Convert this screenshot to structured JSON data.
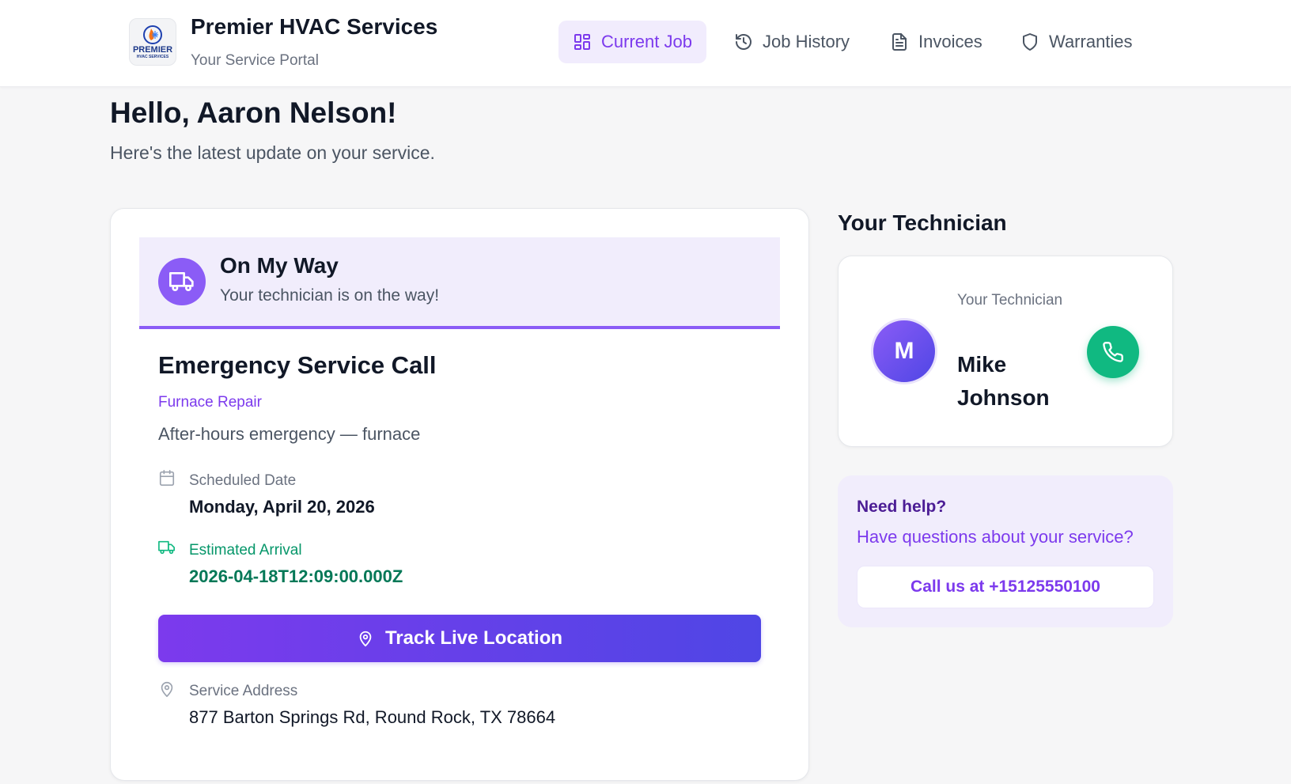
{
  "header": {
    "brand_title": "Premier HVAC Services",
    "brand_subtitle": "Your Service Portal",
    "logo_text": "PREMIER",
    "logo_subtext": "HVAC SERVICES",
    "nav": [
      {
        "label": "Current Job",
        "icon": "dashboard-grid-icon",
        "active": true
      },
      {
        "label": "Job History",
        "icon": "history-icon",
        "active": false
      },
      {
        "label": "Invoices",
        "icon": "document-icon",
        "active": false
      },
      {
        "label": "Warranties",
        "icon": "shield-icon",
        "active": false
      }
    ]
  },
  "greeting": {
    "title": "Hello, Aaron Nelson!",
    "subtitle": "Here's the latest update on your service."
  },
  "job": {
    "status": {
      "title": "On My Way",
      "subtitle": "Your technician is on the way!",
      "icon": "truck-icon"
    },
    "title": "Emergency Service Call",
    "type": "Furnace Repair",
    "description": "After-hours emergency — furnace",
    "scheduled": {
      "label": "Scheduled Date",
      "value": "Monday, April 20, 2026",
      "icon": "calendar-icon"
    },
    "arrival": {
      "label": "Estimated Arrival",
      "value": "2026-04-18T12:09:00.000Z",
      "icon": "truck-icon"
    },
    "track_button": "Track Live Location",
    "address": {
      "label": "Service Address",
      "value": "877 Barton Springs Rd, Round Rock, TX 78664",
      "icon": "map-pin-icon"
    }
  },
  "technician": {
    "heading": "Your Technician",
    "label": "Your Technician",
    "initial": "M",
    "name": "Mike Johnson"
  },
  "help": {
    "title": "Need help?",
    "subtitle": "Have questions about your service?",
    "button": "Call us at +15125550100"
  },
  "colors": {
    "accent": "#7c3aed",
    "accent_light": "#f1edfc",
    "success": "#10b981",
    "text": "#111827"
  }
}
